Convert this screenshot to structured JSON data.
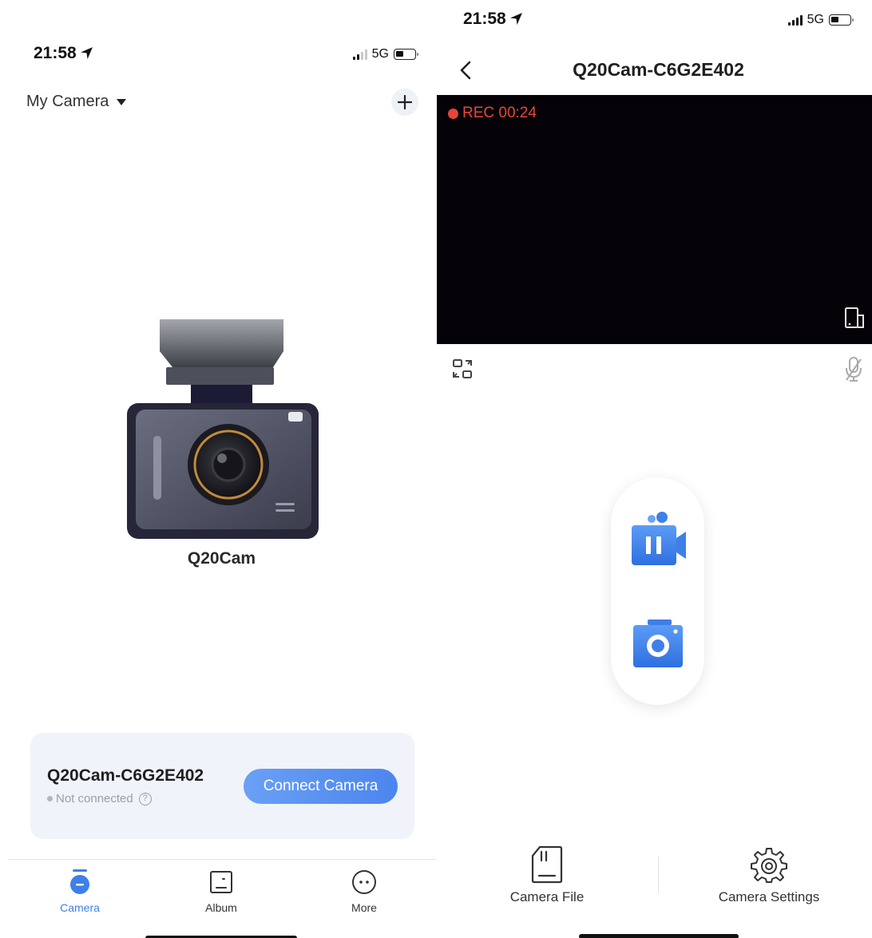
{
  "colors": {
    "accent": "#4c85ee",
    "rec_red": "#e8453a",
    "card_bg": "#f0f3fa",
    "video_bg": "#050307"
  },
  "left": {
    "status": {
      "time": "21:58",
      "network": "5G"
    },
    "header": {
      "title": "My Camera",
      "dropdown_icon": "caret-down-icon",
      "add_icon": "plus-icon"
    },
    "hero": {
      "camera_name": "Q20Cam"
    },
    "device_card": {
      "device_id": "Q20Cam-C6G2E402",
      "status": "Not connected",
      "help_symbol": "?",
      "connect_label": "Connect Camera"
    },
    "tabs": [
      {
        "label": "Camera",
        "icon": "camera-tab-icon",
        "active": true
      },
      {
        "label": "Album",
        "icon": "album-icon",
        "active": false
      },
      {
        "label": "More",
        "icon": "more-icon",
        "active": false
      }
    ]
  },
  "right": {
    "status": {
      "time": "21:58",
      "network": "5G"
    },
    "title": "Q20Cam-C6G2E402",
    "video": {
      "rec_label": "REC 00:24"
    },
    "actions": [
      {
        "label": "Camera File",
        "icon": "sd-card-icon"
      },
      {
        "label": "Camera Settings",
        "icon": "gear-icon"
      }
    ]
  }
}
